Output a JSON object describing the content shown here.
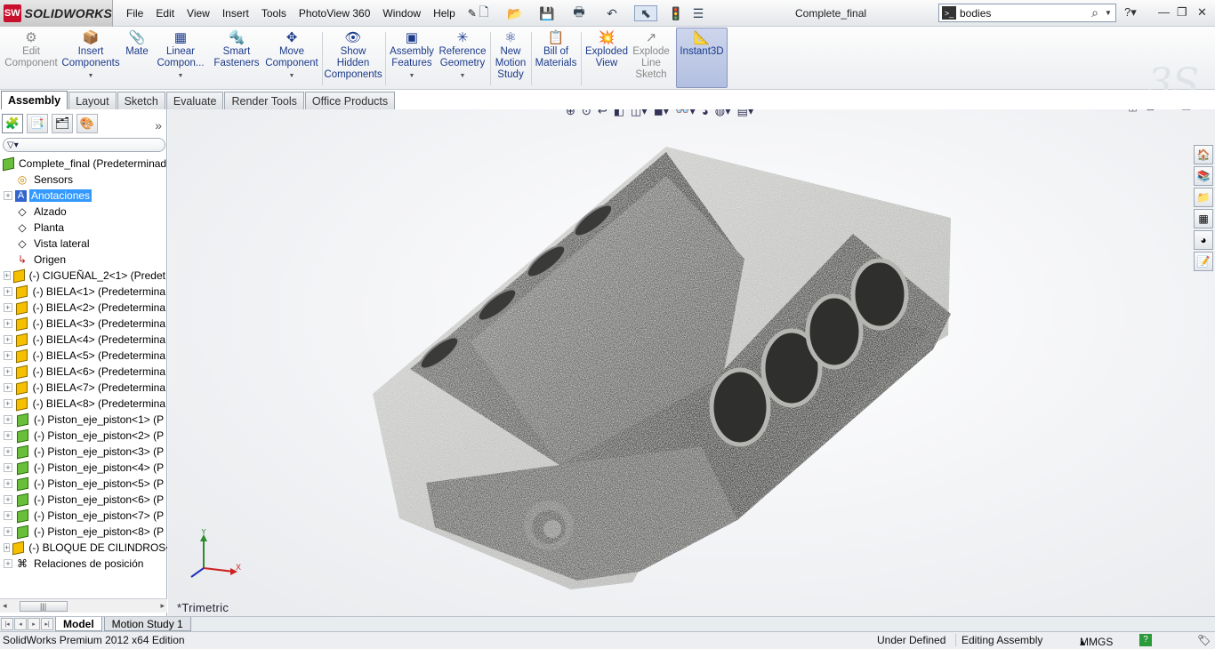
{
  "app": {
    "logo_text": "SOLIDWORKS",
    "logo_icon": "ds-solidworks-icon",
    "document_title": "Complete_final"
  },
  "menu": [
    "File",
    "Edit",
    "View",
    "Insert",
    "Tools",
    "PhotoView 360",
    "Window",
    "Help"
  ],
  "search": {
    "value": "bodies"
  },
  "command_manager": [
    {
      "label": "Edit\nComponent",
      "icon": "edit-component-icon",
      "enabled": false
    },
    {
      "label": "Insert\nComponents",
      "icon": "insert-components-icon",
      "enabled": true
    },
    {
      "label": "Mate",
      "icon": "mate-icon",
      "enabled": true
    },
    {
      "label": "Linear\nCompon...",
      "icon": "linear-pattern-icon",
      "enabled": true
    },
    {
      "label": "Smart\nFasteners",
      "icon": "smart-fasteners-icon",
      "enabled": true
    },
    {
      "label": "Move\nComponent",
      "icon": "move-component-icon",
      "enabled": true
    },
    {
      "label": "Show\nHidden\nComponents",
      "icon": "show-hidden-icon",
      "enabled": true
    },
    {
      "label": "Assembly\nFeatures",
      "icon": "assembly-features-icon",
      "enabled": true
    },
    {
      "label": "Reference\nGeometry",
      "icon": "reference-geometry-icon",
      "enabled": true
    },
    {
      "label": "New\nMotion\nStudy",
      "icon": "motion-study-icon",
      "enabled": true
    },
    {
      "label": "Bill of\nMaterials",
      "icon": "bill-of-materials-icon",
      "enabled": true
    },
    {
      "label": "Exploded\nView",
      "icon": "exploded-view-icon",
      "enabled": true
    },
    {
      "label": "Explode\nLine\nSketch",
      "icon": "explode-line-sketch-icon",
      "enabled": false
    },
    {
      "label": "Instant3D",
      "icon": "instant3d-icon",
      "enabled": true,
      "active": true
    }
  ],
  "tabs": [
    {
      "label": "Assembly",
      "active": true
    },
    {
      "label": "Layout"
    },
    {
      "label": "Sketch"
    },
    {
      "label": "Evaluate"
    },
    {
      "label": "Render Tools"
    },
    {
      "label": "Office Products"
    }
  ],
  "feature_tree": {
    "root": "Complete_final  (Predeterminad",
    "items": [
      {
        "label": "Sensors",
        "icon": "sensors-icon",
        "expandable": false
      },
      {
        "label": "Anotaciones",
        "icon": "annotations-icon",
        "expandable": true,
        "selected": true
      },
      {
        "label": "Alzado",
        "icon": "plane-icon",
        "expandable": false
      },
      {
        "label": "Planta",
        "icon": "plane-icon",
        "expandable": false
      },
      {
        "label": "Vista lateral",
        "icon": "plane-icon",
        "expandable": false
      },
      {
        "label": "Origen",
        "icon": "origin-icon",
        "expandable": false
      },
      {
        "label": "(-) CIGUEÑAL_2<1> (Predet",
        "icon": "part-icon",
        "expandable": true
      },
      {
        "label": "(-) BIELA<1> (Predetermina",
        "icon": "part-icon",
        "expandable": true
      },
      {
        "label": "(-) BIELA<2> (Predetermina",
        "icon": "part-icon",
        "expandable": true
      },
      {
        "label": "(-) BIELA<3> (Predetermina",
        "icon": "part-icon",
        "expandable": true
      },
      {
        "label": "(-) BIELA<4> (Predetermina",
        "icon": "part-icon",
        "expandable": true
      },
      {
        "label": "(-) BIELA<5> (Predetermina",
        "icon": "part-icon",
        "expandable": true
      },
      {
        "label": "(-) BIELA<6> (Predetermina",
        "icon": "part-icon",
        "expandable": true
      },
      {
        "label": "(-) BIELA<7> (Predetermina",
        "icon": "part-icon",
        "expandable": true
      },
      {
        "label": "(-) BIELA<8> (Predetermina",
        "icon": "part-icon",
        "expandable": true
      },
      {
        "label": "(-) Piston_eje_piston<1> (P",
        "icon": "subassembly-icon",
        "expandable": true
      },
      {
        "label": "(-) Piston_eje_piston<2> (P",
        "icon": "subassembly-icon",
        "expandable": true
      },
      {
        "label": "(-) Piston_eje_piston<3> (P",
        "icon": "subassembly-icon",
        "expandable": true
      },
      {
        "label": "(-) Piston_eje_piston<4> (P",
        "icon": "subassembly-icon",
        "expandable": true
      },
      {
        "label": "(-) Piston_eje_piston<5> (P",
        "icon": "subassembly-icon",
        "expandable": true
      },
      {
        "label": "(-) Piston_eje_piston<6> (P",
        "icon": "subassembly-icon",
        "expandable": true
      },
      {
        "label": "(-) Piston_eje_piston<7> (P",
        "icon": "subassembly-icon",
        "expandable": true
      },
      {
        "label": "(-) Piston_eje_piston<8> (P",
        "icon": "subassembly-icon",
        "expandable": true
      },
      {
        "label": "(-) BLOQUE DE CILINDROS<",
        "icon": "part-icon",
        "expandable": true
      },
      {
        "label": "Relaciones de posición",
        "icon": "mates-folder-icon",
        "expandable": true
      }
    ]
  },
  "viewport": {
    "orientation": "*Trimetric",
    "axes": {
      "x": "X",
      "y": "Y"
    }
  },
  "bottom_tabs": [
    {
      "label": "Model",
      "active": true
    },
    {
      "label": "Motion Study 1"
    }
  ],
  "status_bar": {
    "edition": "SolidWorks Premium 2012 x64 Edition",
    "definition": "Under Defined",
    "mode": "Editing Assembly",
    "units": "MMGS"
  },
  "colors": {
    "accent": "#1a3a8a",
    "selection": "#3399ff",
    "part_yellow": "#f5c000",
    "subassembly_green": "#6abf3a",
    "model_metal": "#6b6b6b"
  }
}
